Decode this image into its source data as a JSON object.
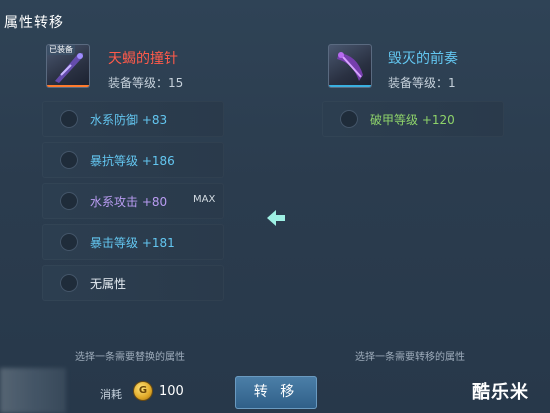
{
  "title": "属性转移",
  "left_item": {
    "tag": "已装备",
    "name": "天蝎的撞针",
    "name_color": "#ff5a4a",
    "level_label": "装备等级：",
    "level": "15",
    "icon": "scorpion-needle-weapon-icon"
  },
  "right_item": {
    "name": "毁灭的前奏",
    "name_color": "#63c6f0",
    "level_label": "装备等级：",
    "level": "1",
    "icon": "destruction-prelude-weapon-icon"
  },
  "left_slots": [
    {
      "name": "水系防御",
      "value": "+83",
      "color": "#63c6f0"
    },
    {
      "name": "暴抗等级",
      "value": "+186",
      "color": "#63c6f0"
    },
    {
      "name": "水系攻击",
      "value": "+80",
      "color": "#b99cf2",
      "tag": "MAX"
    },
    {
      "name": "暴击等级",
      "value": "+181",
      "color": "#63c6f0"
    },
    {
      "name": "无属性",
      "value": "",
      "color": "#e6edf3"
    }
  ],
  "right_slots": [
    {
      "name": "破甲等级",
      "value": "+120",
      "color": "#8ed36a"
    }
  ],
  "hints": {
    "left": "选择一条需要替换的属性",
    "right": "选择一条需要转移的属性"
  },
  "cost": {
    "label": "消耗",
    "value": "100",
    "icon": "gold-coin-icon"
  },
  "transfer_button": "转 移",
  "watermark": "酷乐米"
}
